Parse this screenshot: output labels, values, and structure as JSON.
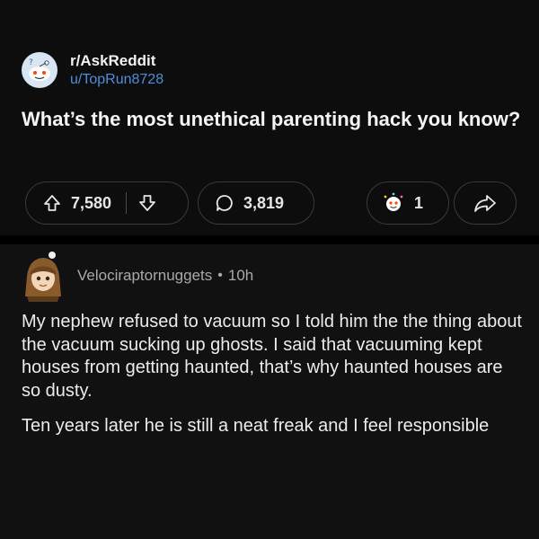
{
  "post": {
    "subreddit": "r/AskReddit",
    "username": "u/TopRun8728",
    "title": "What’s the most unethical parenting hack you know?",
    "upvotes": "7,580",
    "comments": "3,819",
    "awards": "1"
  },
  "comment": {
    "author": "Velociraptornuggets",
    "separator": "•",
    "time": "10h",
    "paragraphs": [
      "My nephew refused to vacuum so I told him the the thing about the vacuum sucking up ghosts. I said that vacuuming kept houses from getting haunted, that’s why haunted houses are so dusty.",
      "Ten years later he is still a neat freak and I feel responsible"
    ]
  },
  "colors": {
    "background": "#0b0b0b",
    "username_link": "#4e8fd9",
    "text": "#ececec",
    "muted": "#a9a9a9"
  },
  "icons": {
    "subreddit_avatar": "reddit-snoo-icon",
    "upvote": "upvote-arrow-icon",
    "downvote": "downvote-arrow-icon",
    "comments": "comment-bubble-icon",
    "award": "award-icon",
    "share": "share-arrow-icon",
    "commenter_avatar": "user-avatar-icon"
  }
}
